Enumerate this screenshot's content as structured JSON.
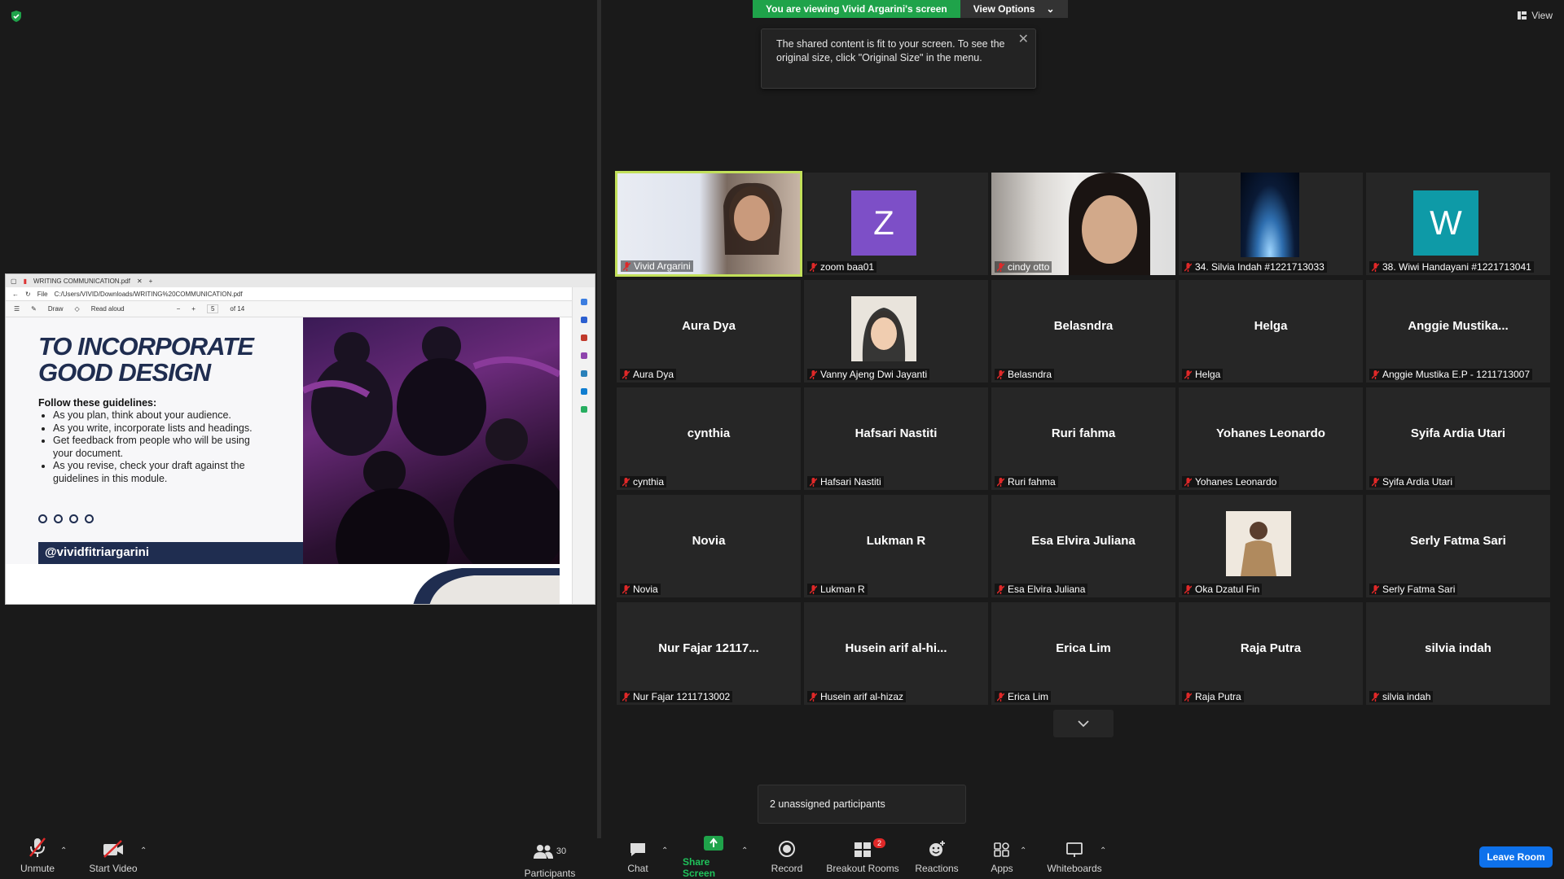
{
  "banner": {
    "viewing_text": "You are viewing Vivid Argarini's screen",
    "view_options": "View Options"
  },
  "tooltip": {
    "text": "The shared content is fit to your screen. To see the original size, click \"Original Size\" in the menu."
  },
  "top_right": {
    "view_label": "View"
  },
  "shared": {
    "tab_title": "WRITING COMMUNICATION.pdf",
    "address_prefix": "File",
    "address": "C:/Users/VIVID/Downloads/WRITING%20COMMUNICATION.pdf",
    "draw_label": "Draw",
    "read_aloud": "Read aloud",
    "page_current": "5",
    "page_total": "of 14",
    "slide": {
      "title_line1": "TO INCORPORATE",
      "title_line2": "GOOD DESIGN",
      "subtitle": "Follow these guidelines:",
      "bullets": [
        "As you plan, think about your audience.",
        "As you write, incorporate lists and headings.",
        "Get feedback from people who will be using your document.",
        "As you revise, check your draft against the guidelines in this module."
      ],
      "handle": "@vividfitriargarini"
    }
  },
  "participants": [
    {
      "display": "",
      "label": "Vivid Argarini",
      "kind": "video",
      "active": true
    },
    {
      "display": "Z",
      "label": "zoom baa01",
      "kind": "avatar",
      "color": "#7d4fc7"
    },
    {
      "display": "",
      "label": "cindy otto",
      "kind": "video"
    },
    {
      "display": "",
      "label": "34. Silvia Indah #1221713033",
      "kind": "image"
    },
    {
      "display": "W",
      "label": "38. Wiwi Handayani #1221713041",
      "kind": "avatar",
      "color": "#0e9aa7"
    },
    {
      "display": "Aura Dya",
      "label": "Aura Dya",
      "kind": "name"
    },
    {
      "display": "",
      "label": "Vanny Ajeng Dwi Jayanti",
      "kind": "photo"
    },
    {
      "display": "Belasndra",
      "label": "Belasndra",
      "kind": "name"
    },
    {
      "display": "Helga",
      "label": "Helga",
      "kind": "name"
    },
    {
      "display": "Anggie  Mustika...",
      "label": "Anggie Mustika E.P - 1211713007",
      "kind": "name"
    },
    {
      "display": "cynthia",
      "label": "cynthia",
      "kind": "name"
    },
    {
      "display": "Hafsari Nastiti",
      "label": "Hafsari Nastiti",
      "kind": "name"
    },
    {
      "display": "Ruri fahma",
      "label": "Ruri fahma",
      "kind": "name"
    },
    {
      "display": "Yohanes Leonardo",
      "label": "Yohanes Leonardo",
      "kind": "name"
    },
    {
      "display": "Syifa Ardia Utari",
      "label": "Syifa Ardia Utari",
      "kind": "name"
    },
    {
      "display": "Novia",
      "label": "Novia",
      "kind": "name"
    },
    {
      "display": "Lukman R",
      "label": "Lukman R",
      "kind": "name"
    },
    {
      "display": "Esa Elvira Juliana",
      "label": "Esa Elvira Juliana",
      "kind": "name"
    },
    {
      "display": "",
      "label": "Oka Dzatul Fin",
      "kind": "photo2"
    },
    {
      "display": "Serly Fatma Sari",
      "label": "Serly Fatma Sari",
      "kind": "name"
    },
    {
      "display": "Nur Fajar 12117...",
      "label": "Nur Fajar 1211713002",
      "kind": "name"
    },
    {
      "display": "Husein  arif  al-hi...",
      "label": "Husein arif al-hizaz",
      "kind": "name"
    },
    {
      "display": "Erica Lim",
      "label": "Erica Lim",
      "kind": "name"
    },
    {
      "display": "Raja Putra",
      "label": "Raja Putra",
      "kind": "name"
    },
    {
      "display": "silvia indah",
      "label": "silvia indah",
      "kind": "name"
    }
  ],
  "unassigned": "2 unassigned participants",
  "toolbar": {
    "unmute": "Unmute",
    "start_video": "Start Video",
    "participants": "Participants",
    "participants_count": "30",
    "chat": "Chat",
    "share_screen": "Share Screen",
    "record": "Record",
    "breakout_rooms": "Breakout Rooms",
    "breakout_badge": "2",
    "reactions": "Reactions",
    "apps": "Apps",
    "whiteboards": "Whiteboards",
    "leave": "Leave Room"
  }
}
